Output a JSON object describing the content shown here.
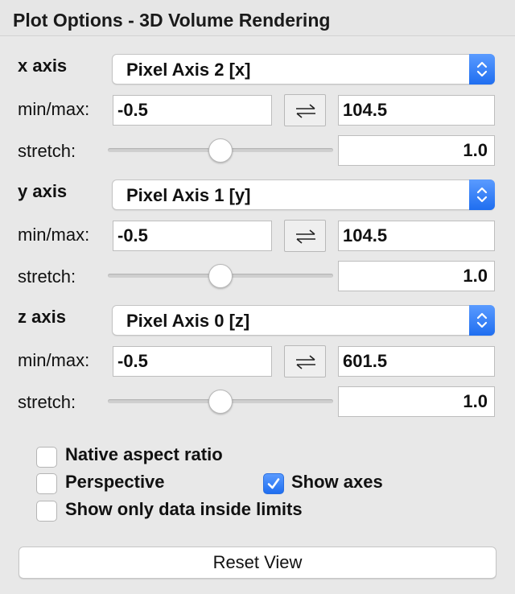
{
  "window": {
    "title": "Plot Options - 3D Volume Rendering"
  },
  "axes": [
    {
      "label": "x axis",
      "selection": "Pixel Axis 2 [x]",
      "minmax_label": "min/max:",
      "min": "-0.5",
      "max": "104.5",
      "stretch_label": "stretch:",
      "stretch": "1.0",
      "slider_level": 0.5
    },
    {
      "label": "y axis",
      "selection": "Pixel Axis 1 [y]",
      "minmax_label": "min/max:",
      "min": "-0.5",
      "max": "104.5",
      "stretch_label": "stretch:",
      "stretch": "1.0",
      "slider_level": 0.5
    },
    {
      "label": "z axis",
      "selection": "Pixel Axis 0 [z]",
      "minmax_label": "min/max:",
      "min": "-0.5",
      "max": "601.5",
      "stretch_label": "stretch:",
      "stretch": "1.0",
      "slider_level": 0.5
    }
  ],
  "options": {
    "native_aspect": {
      "label": "Native aspect ratio",
      "checked": false
    },
    "perspective": {
      "label": "Perspective",
      "checked": false
    },
    "show_axes": {
      "label": "Show axes",
      "checked": true
    },
    "show_inside_limits": {
      "label": "Show only data inside limits",
      "checked": false
    }
  },
  "reset_label": "Reset View",
  "colors": {
    "accent": "#2f7cf6",
    "background": "#e8e8e8"
  },
  "icons": {
    "swap": "swap-arrows-icon",
    "stepper": "up-down-chevron-icon",
    "check": "checkmark-icon"
  }
}
